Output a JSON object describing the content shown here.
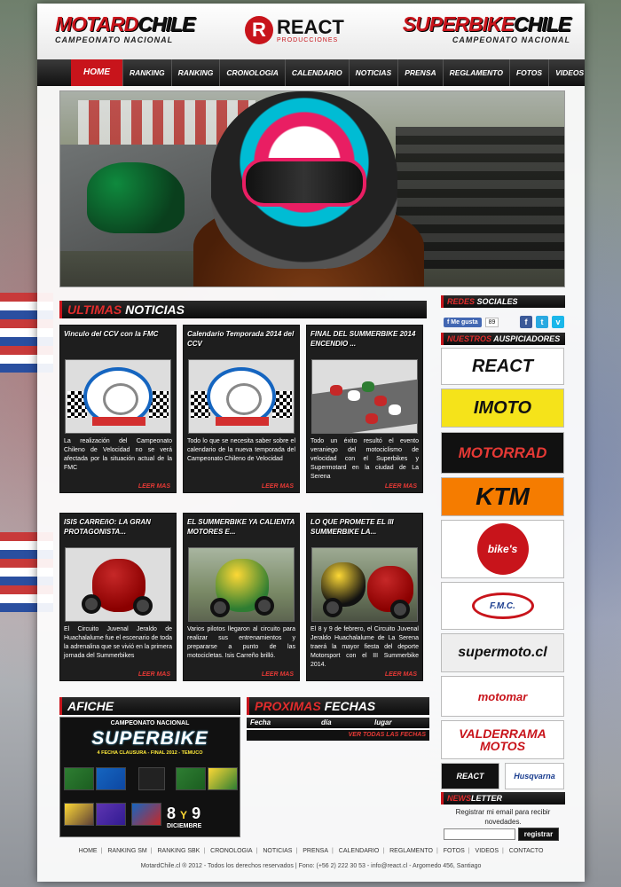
{
  "header": {
    "left_logo": {
      "main_a": "MOTARD",
      "main_b": "CHILE",
      "sub": "CAMPEONATO NACIONAL"
    },
    "center_logo": {
      "mark": "R",
      "name": "REACT",
      "sub": "PRODUCCIONES"
    },
    "right_logo": {
      "main_a": "SUPERBIKE",
      "main_b": "CHILE",
      "sub": "CAMPEONATO NACIONAL"
    }
  },
  "nav": {
    "items": [
      {
        "label": "HOME"
      },
      {
        "label": "RANKING SM"
      },
      {
        "label": "RANKING SBK"
      },
      {
        "label": "CRONOLOGIA"
      },
      {
        "label": "CALENDARIO"
      },
      {
        "label": "NOTICIAS"
      },
      {
        "label": "PRENSA"
      },
      {
        "label": "REGLAMENTO"
      },
      {
        "label": "FOTOS"
      },
      {
        "label": "VIDEOS"
      }
    ],
    "active_index": 0
  },
  "news": {
    "head_red": "ULTIMAS",
    "head_white": " NOTICIAS",
    "more_label": "LEER MAS",
    "cards": [
      {
        "title": "Vinculo del CCV con la FMC",
        "text": "La realización del Campeonato Chileno de Velocidad no se verá afectada por la situación actual de la FMC",
        "image": "ccv-logo"
      },
      {
        "title": "Calendario Temporada 2014 del CCV",
        "text": "Todo lo que se necesita saber sobre el calendario de la nueva temporada del Campeonato Chileno de Velocidad",
        "image": "ccv-logo"
      },
      {
        "title": "FINAL DEL SUMMERBIKE 2014 ENCENDIO ...",
        "text": "Todo un éxito resultó el evento veraniego del motociclismo de velocidad con el Superbikes y Supermotard en la ciudad de La Serena",
        "image": "race-photo"
      },
      {
        "title": "ISIS CARREñO: LA GRAN PROTAGONISTA...",
        "text": "El Circuito Juvenal Jeraldo de Huachalalume fue el escenario de toda la adrenalina que se vivió en la primera jornada del Summerbikes",
        "image": "red-bike-photo"
      },
      {
        "title": "EL SUMMERBIKE YA CALIENTA MOTORES E...",
        "text": "Varios pilotos llegaron al circuito para realizar sus entrenamientos y prepararse a punto de las motocicletas. Isis Carreño brilló.",
        "image": "yellow-bike-photo"
      },
      {
        "title": "LO QUE PROMETE EL III SUMMERBIKE LA...",
        "text": "El 8 y 9 de febrero, el Circuito Juvenal Jeraldo Huachalalume de La Serena traerá la mayor fiesta del deporte Motorsport con el III Summerbike 2014.",
        "image": "two-bikes-photo"
      }
    ]
  },
  "afiche": {
    "head": "AFICHE",
    "campeonato": "CAMPEONATO NACIONAL",
    "superbike": "SUPERBIKE",
    "fecha": "4 FECHA CLAUSURA - FINAL 2012 - TEMUCO",
    "day_a": "8",
    "day_y": "Y",
    "day_b": "9",
    "month": "DICIEMBRE"
  },
  "proximas": {
    "head_red": "PROXIMAS",
    "head_white": " FECHAS",
    "col_fecha": "Fecha",
    "col_dia": "día",
    "col_lugar": "lugar",
    "ver_todas": "VER TODAS LAS FECHAS"
  },
  "sidebar": {
    "redes_red": "REDES",
    "redes_white": " SOCIALES",
    "fb_like": "Me gusta",
    "fb_count": "89",
    "social_icons": [
      "facebook-icon",
      "twitter-icon",
      "vimeo-icon"
    ],
    "sponsors_red": "NUESTROS",
    "sponsors_white": " AUSPICIADORES",
    "sponsors": [
      {
        "name": "REACT",
        "bg": "#ffffff",
        "color": "#c8141b"
      },
      {
        "name": "IMOTO",
        "bg": "#f5e31a",
        "color": "#111111"
      },
      {
        "name": "MOTORRAD",
        "bg": "#111111",
        "color": "#e53935"
      },
      {
        "name": "KTM",
        "bg": "#f57c00",
        "color": "#111111"
      },
      {
        "name": "bike's",
        "bg": "#ffffff",
        "color": "#c8141b"
      },
      {
        "name": "F.M.C.",
        "bg": "#ffffff",
        "color": "#1a3d8f"
      },
      {
        "name": "supermoto.cl",
        "bg": "#eeeeee",
        "color": "#111111"
      },
      {
        "name": "motomar",
        "bg": "#ffffff",
        "color": "#c8141b"
      },
      {
        "name": "VALDERRAMA MOTOS",
        "bg": "#ffffff",
        "color": "#c8141b"
      }
    ],
    "small_sponsors": [
      {
        "name": "REACT",
        "bg": "#111111",
        "color": "#ffffff"
      },
      {
        "name": "Husqvarna",
        "bg": "#ffffff",
        "color": "#1a3d8f"
      }
    ],
    "newsletter_red": "NEWS",
    "newsletter_white": "LETTER",
    "newsletter_text": "Registrar mi email para recibir novedades.",
    "newsletter_btn": "registrar"
  },
  "footer": {
    "links": [
      "HOME",
      "RANKING SM",
      "RANKING SBK",
      "CRONOLOGIA",
      "NOTICIAS",
      "PRENSA",
      "CALENDARIO",
      "REGLAMENTO",
      "FOTOS",
      "VIDEOS",
      "CONTACTO"
    ],
    "copyright": "MotardChile.cl ® 2012 - Todos los derechos reservados | Fono: (+56 2) 222 30 53 - info@react.cl - Argomedo 456, Santiago"
  },
  "colors": {
    "accent": "#c8141b",
    "dark": "#111111"
  }
}
